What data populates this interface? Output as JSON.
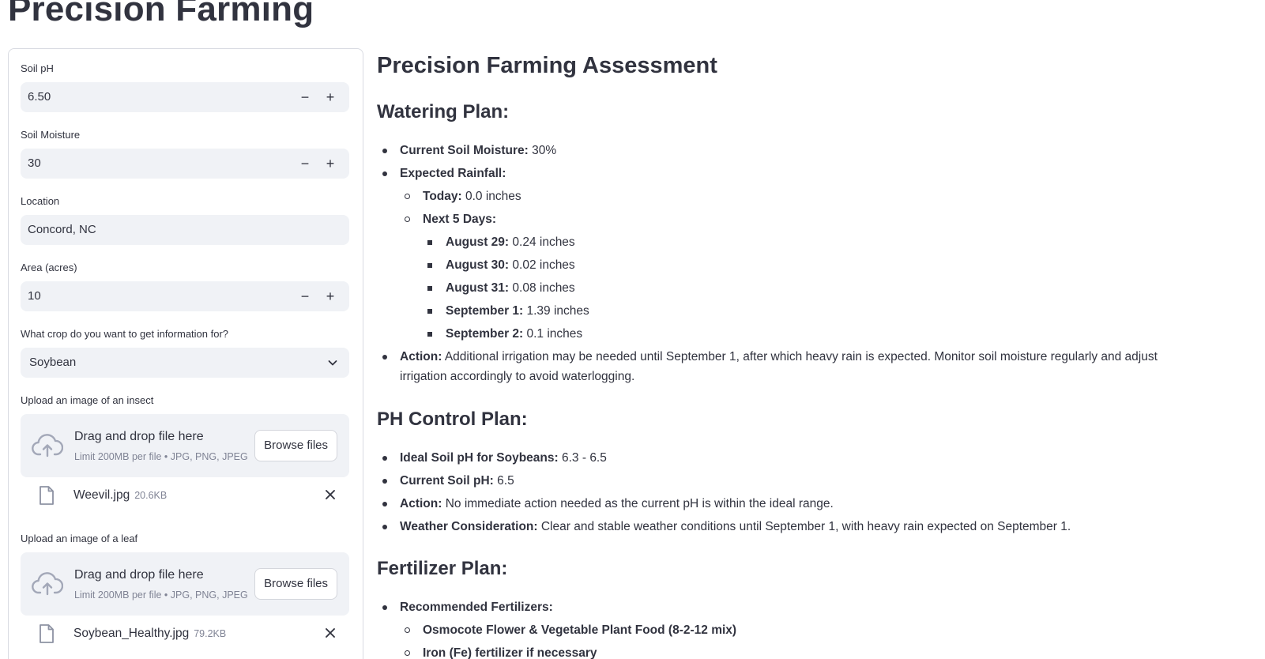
{
  "app": {
    "title": "Precision Farming"
  },
  "sidebar": {
    "soil_ph": {
      "label": "Soil pH",
      "value": "6.50"
    },
    "soil_moisture": {
      "label": "Soil Moisture",
      "value": "30"
    },
    "location": {
      "label": "Location",
      "value": "Concord, NC"
    },
    "area": {
      "label": "Area (acres)",
      "value": "10"
    },
    "crop": {
      "label": "What crop do you want to get information for?",
      "value": "Soybean"
    },
    "stepper": {
      "minus": "−",
      "plus": "+"
    },
    "insect_upload": {
      "label": "Upload an image of an insect",
      "drop_title": "Drag and drop file here",
      "drop_sub": "Limit 200MB per file • JPG, PNG, JPEG",
      "browse": "Browse files",
      "file_name": "Weevil.jpg",
      "file_size": "20.6KB"
    },
    "leaf_upload": {
      "label": "Upload an image of a leaf",
      "drop_title": "Drag and drop file here",
      "drop_sub": "Limit 200MB per file • JPG, PNG, JPEG",
      "browse": "Browse files",
      "file_name": "Soybean_Healthy.jpg",
      "file_size": "79.2KB"
    }
  },
  "main": {
    "title": "Precision Farming Assessment",
    "watering": {
      "heading": "Watering Plan:",
      "current_moisture": {
        "label": "Current Soil Moisture:",
        "value": " 30%"
      },
      "expected_rainfall": {
        "label": "Expected Rainfall:"
      },
      "today": {
        "label": "Today:",
        "value": " 0.0 inches"
      },
      "next5": {
        "label": "Next 5 Days:"
      },
      "days": [
        {
          "label": "August 29:",
          "value": " 0.24 inches"
        },
        {
          "label": "August 30:",
          "value": " 0.02 inches"
        },
        {
          "label": "August 31:",
          "value": " 0.08 inches"
        },
        {
          "label": "September 1:",
          "value": " 1.39 inches"
        },
        {
          "label": "September 2:",
          "value": " 0.1 inches"
        }
      ],
      "action": {
        "label": "Action:",
        "value": " Additional irrigation may be needed until September 1, after which heavy rain is expected. Monitor soil moisture regularly and adjust irrigation accordingly to avoid waterlogging."
      }
    },
    "ph": {
      "heading": "PH Control Plan:",
      "ideal": {
        "label": "Ideal Soil pH for Soybeans:",
        "value": " 6.3 - 6.5"
      },
      "current": {
        "label": "Current Soil pH:",
        "value": " 6.5"
      },
      "action": {
        "label": "Action:",
        "value": " No immediate action needed as the current pH is within the ideal range."
      },
      "weather": {
        "label": "Weather Consideration:",
        "value": " Clear and stable weather conditions until September 1, with heavy rain expected on September 1."
      }
    },
    "fertilizer": {
      "heading": "Fertilizer Plan:",
      "recommended": {
        "label": "Recommended Fertilizers:"
      },
      "items": [
        "Osmocote Flower & Vegetable Plant Food (8-2-12 mix)",
        "Iron (Fe) fertilizer if necessary"
      ]
    }
  }
}
